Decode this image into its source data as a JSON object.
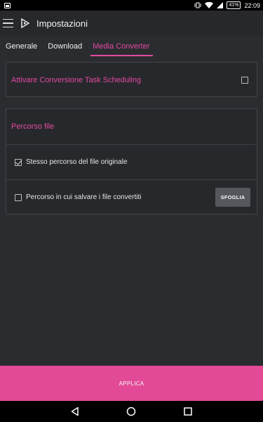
{
  "status_bar": {
    "battery": "41%",
    "time": "22:09"
  },
  "app_bar": {
    "title": "Impostazioni"
  },
  "tabs": [
    {
      "label": "Generale",
      "active": false
    },
    {
      "label": "Download",
      "active": false
    },
    {
      "label": "Media Converter",
      "active": true
    }
  ],
  "scheduling": {
    "label": "Attivare Conversione Task Scheduling",
    "checked": false
  },
  "file_path": {
    "header": "Percorso file",
    "same_path_label": "Stesso percorso del file originale",
    "same_path_checked": true,
    "custom_path_label": "Percorso in cui salvare i file convertiti",
    "custom_path_checked": false,
    "browse_label": "SFOGLIA"
  },
  "apply_label": "APPLICA",
  "colors": {
    "accent": "#e24aa0",
    "background": "#2b2c30",
    "card": "#27282c"
  }
}
